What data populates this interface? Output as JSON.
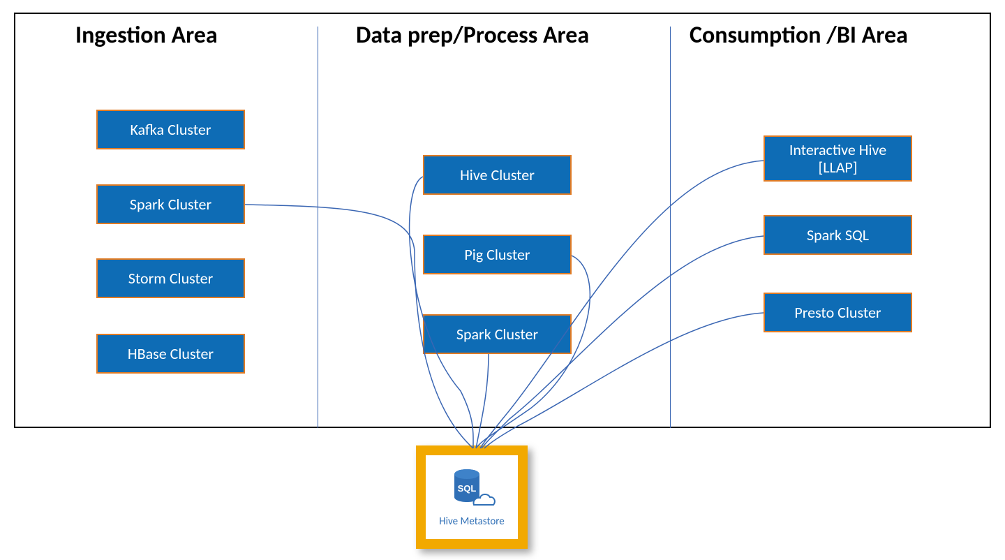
{
  "areas": {
    "ingestion": {
      "title": "Ingestion Area"
    },
    "process": {
      "title": "Data prep/Process Area"
    },
    "consume": {
      "title": "Consumption /BI Area"
    }
  },
  "nodes": {
    "ingestion": [
      {
        "label": "Kafka Cluster"
      },
      {
        "label": "Spark Cluster"
      },
      {
        "label": "Storm Cluster"
      },
      {
        "label": "HBase Cluster"
      }
    ],
    "process": [
      {
        "label": "Hive Cluster"
      },
      {
        "label": "Pig Cluster"
      },
      {
        "label": "Spark Cluster"
      }
    ],
    "consume": [
      {
        "label": "Interactive Hive [LLAP]"
      },
      {
        "label": "Spark SQL"
      },
      {
        "label": "Presto Cluster"
      }
    ]
  },
  "metastore": {
    "label": "Hive Metastore",
    "icon_text": "SQL"
  },
  "colors": {
    "node_fill": "#0e6cb5",
    "node_border": "#e07b24",
    "connector": "#3a66b3",
    "metastore_border": "#f2a900"
  }
}
